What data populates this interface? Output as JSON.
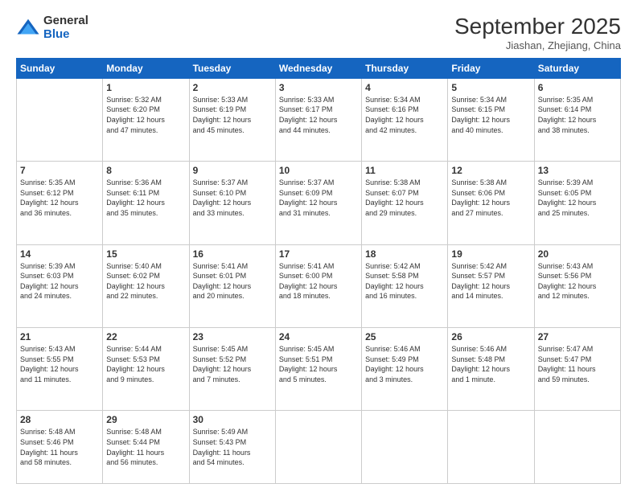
{
  "logo": {
    "line1": "General",
    "line2": "Blue"
  },
  "title": "September 2025",
  "location": "Jiashan, Zhejiang, China",
  "weekdays": [
    "Sunday",
    "Monday",
    "Tuesday",
    "Wednesday",
    "Thursday",
    "Friday",
    "Saturday"
  ],
  "weeks": [
    [
      {
        "day": "",
        "info": ""
      },
      {
        "day": "1",
        "info": "Sunrise: 5:32 AM\nSunset: 6:20 PM\nDaylight: 12 hours\nand 47 minutes."
      },
      {
        "day": "2",
        "info": "Sunrise: 5:33 AM\nSunset: 6:19 PM\nDaylight: 12 hours\nand 45 minutes."
      },
      {
        "day": "3",
        "info": "Sunrise: 5:33 AM\nSunset: 6:17 PM\nDaylight: 12 hours\nand 44 minutes."
      },
      {
        "day": "4",
        "info": "Sunrise: 5:34 AM\nSunset: 6:16 PM\nDaylight: 12 hours\nand 42 minutes."
      },
      {
        "day": "5",
        "info": "Sunrise: 5:34 AM\nSunset: 6:15 PM\nDaylight: 12 hours\nand 40 minutes."
      },
      {
        "day": "6",
        "info": "Sunrise: 5:35 AM\nSunset: 6:14 PM\nDaylight: 12 hours\nand 38 minutes."
      }
    ],
    [
      {
        "day": "7",
        "info": "Sunrise: 5:35 AM\nSunset: 6:12 PM\nDaylight: 12 hours\nand 36 minutes."
      },
      {
        "day": "8",
        "info": "Sunrise: 5:36 AM\nSunset: 6:11 PM\nDaylight: 12 hours\nand 35 minutes."
      },
      {
        "day": "9",
        "info": "Sunrise: 5:37 AM\nSunset: 6:10 PM\nDaylight: 12 hours\nand 33 minutes."
      },
      {
        "day": "10",
        "info": "Sunrise: 5:37 AM\nSunset: 6:09 PM\nDaylight: 12 hours\nand 31 minutes."
      },
      {
        "day": "11",
        "info": "Sunrise: 5:38 AM\nSunset: 6:07 PM\nDaylight: 12 hours\nand 29 minutes."
      },
      {
        "day": "12",
        "info": "Sunrise: 5:38 AM\nSunset: 6:06 PM\nDaylight: 12 hours\nand 27 minutes."
      },
      {
        "day": "13",
        "info": "Sunrise: 5:39 AM\nSunset: 6:05 PM\nDaylight: 12 hours\nand 25 minutes."
      }
    ],
    [
      {
        "day": "14",
        "info": "Sunrise: 5:39 AM\nSunset: 6:03 PM\nDaylight: 12 hours\nand 24 minutes."
      },
      {
        "day": "15",
        "info": "Sunrise: 5:40 AM\nSunset: 6:02 PM\nDaylight: 12 hours\nand 22 minutes."
      },
      {
        "day": "16",
        "info": "Sunrise: 5:41 AM\nSunset: 6:01 PM\nDaylight: 12 hours\nand 20 minutes."
      },
      {
        "day": "17",
        "info": "Sunrise: 5:41 AM\nSunset: 6:00 PM\nDaylight: 12 hours\nand 18 minutes."
      },
      {
        "day": "18",
        "info": "Sunrise: 5:42 AM\nSunset: 5:58 PM\nDaylight: 12 hours\nand 16 minutes."
      },
      {
        "day": "19",
        "info": "Sunrise: 5:42 AM\nSunset: 5:57 PM\nDaylight: 12 hours\nand 14 minutes."
      },
      {
        "day": "20",
        "info": "Sunrise: 5:43 AM\nSunset: 5:56 PM\nDaylight: 12 hours\nand 12 minutes."
      }
    ],
    [
      {
        "day": "21",
        "info": "Sunrise: 5:43 AM\nSunset: 5:55 PM\nDaylight: 12 hours\nand 11 minutes."
      },
      {
        "day": "22",
        "info": "Sunrise: 5:44 AM\nSunset: 5:53 PM\nDaylight: 12 hours\nand 9 minutes."
      },
      {
        "day": "23",
        "info": "Sunrise: 5:45 AM\nSunset: 5:52 PM\nDaylight: 12 hours\nand 7 minutes."
      },
      {
        "day": "24",
        "info": "Sunrise: 5:45 AM\nSunset: 5:51 PM\nDaylight: 12 hours\nand 5 minutes."
      },
      {
        "day": "25",
        "info": "Sunrise: 5:46 AM\nSunset: 5:49 PM\nDaylight: 12 hours\nand 3 minutes."
      },
      {
        "day": "26",
        "info": "Sunrise: 5:46 AM\nSunset: 5:48 PM\nDaylight: 12 hours\nand 1 minute."
      },
      {
        "day": "27",
        "info": "Sunrise: 5:47 AM\nSunset: 5:47 PM\nDaylight: 11 hours\nand 59 minutes."
      }
    ],
    [
      {
        "day": "28",
        "info": "Sunrise: 5:48 AM\nSunset: 5:46 PM\nDaylight: 11 hours\nand 58 minutes."
      },
      {
        "day": "29",
        "info": "Sunrise: 5:48 AM\nSunset: 5:44 PM\nDaylight: 11 hours\nand 56 minutes."
      },
      {
        "day": "30",
        "info": "Sunrise: 5:49 AM\nSunset: 5:43 PM\nDaylight: 11 hours\nand 54 minutes."
      },
      {
        "day": "",
        "info": ""
      },
      {
        "day": "",
        "info": ""
      },
      {
        "day": "",
        "info": ""
      },
      {
        "day": "",
        "info": ""
      }
    ]
  ]
}
